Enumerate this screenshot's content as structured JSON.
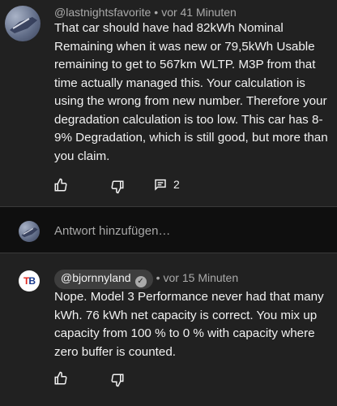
{
  "comment1": {
    "handle": "@lastnightsfavorite",
    "time": "vor 41 Minuten",
    "text": "That car should have had 82kWh Nominal Remaining when it was new or 79,5kWh Usable remaining to get to 567km WLTP. M3P from that time actually managed this. Your calculation is using the wrong from new number. Therefore your degradation calculation is too low. This car has 8-9% Degradation, which is still good, but more than you claim.",
    "reply_count": "2",
    "avatar_icon": "car-avatar"
  },
  "reply_box": {
    "placeholder": "Antwort hinzufügen…",
    "avatar_icon": "car-avatar"
  },
  "comment2": {
    "handle": "@bjornnyland",
    "verified_icon": "check-icon",
    "time": "vor 15 Minuten",
    "text": "Nope. Model 3 Performance never had that many kWh. 76 kWh net capacity is correct. You mix up capacity from 100 % to 0 % with capacity where zero buffer is counted.",
    "avatar_text": "TB",
    "avatar_colors": {
      "T": "#e1261c",
      "B": "#1a3a8c"
    }
  },
  "separator": "•",
  "colors": {
    "panel": "#212121",
    "background": "#0f0f0f",
    "muted": "#aaaaaa",
    "text": "#f1f1f1"
  }
}
